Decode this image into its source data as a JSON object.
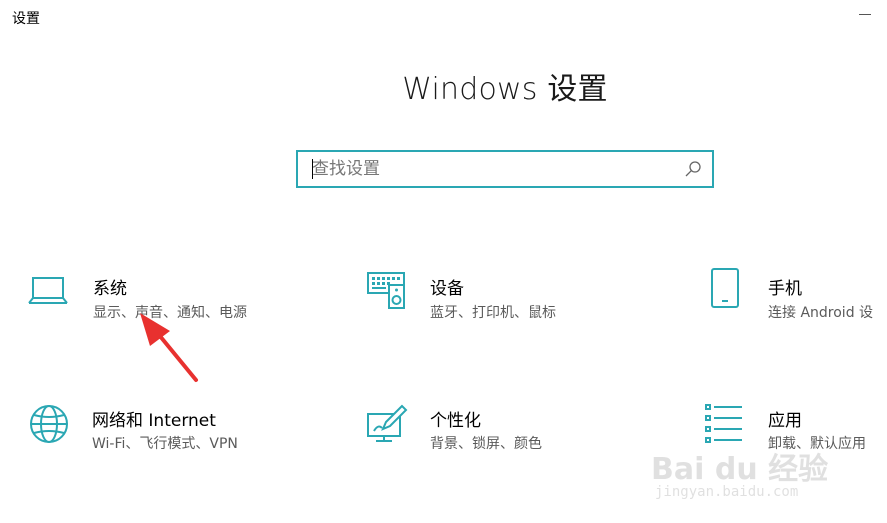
{
  "window": {
    "title": "设置"
  },
  "header": {
    "title": "Windows 设置"
  },
  "search": {
    "placeholder": "查找设置",
    "value": ""
  },
  "tiles": [
    {
      "name": "系统",
      "desc": "显示、声音、通知、电源",
      "icon": "laptop-icon"
    },
    {
      "name": "设备",
      "desc": "蓝牙、打印机、鼠标",
      "icon": "devices-icon"
    },
    {
      "name": "手机",
      "desc": "连接 Android 设",
      "icon": "phone-icon"
    },
    {
      "name": "网络和 Internet",
      "desc": "Wi-Fi、飞行模式、VPN",
      "icon": "globe-icon"
    },
    {
      "name": "个性化",
      "desc": "背景、锁屏、颜色",
      "icon": "personalization-icon"
    },
    {
      "name": "应用",
      "desc": "卸载、默认应用",
      "icon": "apps-icon"
    }
  ],
  "watermark": {
    "text": "Bai du 经验",
    "url": "jingyan.baidu.com"
  },
  "colors": {
    "accent": "#2aa7b3",
    "annotation": "#e8312f"
  }
}
